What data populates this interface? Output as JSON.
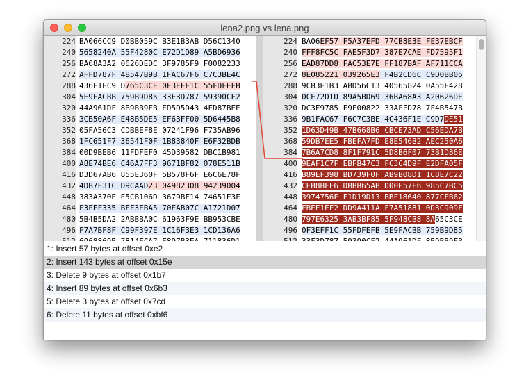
{
  "window": {
    "title": "lena2.png vs lena.png"
  },
  "left_pane": {
    "rows": [
      {
        "num": "224",
        "cells": [
          {
            "t": "BA066CC9 D0BB059C B3E1B3AB D56C1340",
            "c": "none"
          }
        ]
      },
      {
        "num": "240",
        "cells": [
          {
            "t": "5658240A 55F4280C E72D1D89 A5BD6936",
            "c": "blue"
          }
        ]
      },
      {
        "num": "256",
        "cells": [
          {
            "t": "BA68A3A2 0626DEDC 3F9785F9 F0082233",
            "c": "none"
          }
        ]
      },
      {
        "num": "272",
        "cells": [
          {
            "t": "AFFD787F 4B547B9B 1FAC67F6 C7C3BE4C",
            "c": "blue"
          }
        ]
      },
      {
        "num": "288",
        "cells": [
          {
            "t": "436F1EC9 D",
            "c": "none"
          },
          {
            "t": "765C3CE 0F3EFF1C 55FDFEFB",
            "c": "pink"
          }
        ]
      },
      {
        "num": "304",
        "cells": [
          {
            "t": "5E9FACBB 759B9D85 33F3D787 59390CF2",
            "c": "blue"
          }
        ]
      },
      {
        "num": "320",
        "cells": [
          {
            "t": "44A961DF 8B9BB9FB ED5D5D43 4FD87BEE",
            "c": "none"
          }
        ]
      },
      {
        "num": "336",
        "cells": [
          {
            "t": "3CB50A6F E48B5DE5 EF63FF00 5D6445B8",
            "c": "blue"
          }
        ]
      },
      {
        "num": "352",
        "cells": [
          {
            "t": "05FA56C3 CDBBEF8E 07241F96 F735AB96",
            "c": "none"
          }
        ]
      },
      {
        "num": "368",
        "cells": [
          {
            "t": "1FC651F7 36541F0F 1B83840F E6F32BDB",
            "c": "blue"
          }
        ]
      },
      {
        "num": "384",
        "cells": [
          {
            "t": "00D9BEB6 11FDFEF0 45D39582 DBC1B981",
            "c": "none"
          }
        ]
      },
      {
        "num": "400",
        "cells": [
          {
            "t": "A8E74BE6 C46A7FF3 9671BF82 078E511B",
            "c": "blue"
          }
        ]
      },
      {
        "num": "416",
        "cells": [
          {
            "t": "D3D67AB6 855E360F 5B578F6F E6C6E78F",
            "c": "none"
          }
        ]
      },
      {
        "num": "432",
        "cells": [
          {
            "t": "4DB7F31C D9CAAD",
            "c": "blue"
          },
          {
            "t": "23 04982308 94239004",
            "c": "pink"
          }
        ]
      },
      {
        "num": "448",
        "cells": [
          {
            "t": "383A370E E5CB106D 3679BF14 74651E3F",
            "c": "none"
          }
        ]
      },
      {
        "num": "464",
        "cells": [
          {
            "t": "F3FEF335 BFF3EBA5 70EAB07C A1721D07",
            "c": "blue"
          }
        ]
      },
      {
        "num": "480",
        "cells": [
          {
            "t": "5B4B5DA2 2ABBBA0C 61963F9E BB953CBE",
            "c": "none"
          }
        ]
      },
      {
        "num": "496",
        "cells": [
          {
            "t": "F7A7BF8F C99F397E 1C16F3E3 1CD136A6",
            "c": "blue"
          }
        ]
      },
      {
        "num": "512",
        "cells": [
          {
            "t": "6968869B 7814FCA7 E897B3EA 711836D1",
            "c": "none"
          }
        ]
      },
      {
        "num": "528",
        "cells": [
          {
            "t": "1CA7D69D C707F4F2 E70B7AEF D76FC6D0",
            "c": "blue"
          }
        ]
      },
      {
        "num": "544",
        "cells": [
          {
            "t": "21DE5EA7 B811AD7D 0E5F17E7 CFD9EEF5",
            "c": "none"
          }
        ]
      }
    ]
  },
  "right_pane": {
    "rows": [
      {
        "num": "224",
        "cells": [
          {
            "t": "BA06",
            "c": "none"
          },
          {
            "t": "EF57 F5A37EFD 77CB8E3E FE37EBCF",
            "c": "pink"
          }
        ]
      },
      {
        "num": "240",
        "cells": [
          {
            "t": "FFF8FC5C FAE5F3D7 387E7CAE FD7595F1",
            "c": "pink"
          }
        ]
      },
      {
        "num": "256",
        "cells": [
          {
            "t": "EAD87DD8 FAC53E7E FF187BAF AF711CCA",
            "c": "pink"
          }
        ]
      },
      {
        "num": "272",
        "cells": [
          {
            "t": "8E085221 039265E3",
            "c": "pink"
          },
          {
            "t": " F4B2CD6C C9D0BB05",
            "c": "blue"
          }
        ]
      },
      {
        "num": "288",
        "cells": [
          {
            "t": "9CB3E1B3 ABD56C13 40565824 0A55F428",
            "c": "none"
          }
        ]
      },
      {
        "num": "304",
        "cells": [
          {
            "t": "0CE72D1D 89A5BD69 36BA68A3 A20626DE",
            "c": "blue"
          }
        ]
      },
      {
        "num": "320",
        "cells": [
          {
            "t": "DC3F9785 F9F00822 33AFFD78 7F4B547B",
            "c": "none"
          }
        ]
      },
      {
        "num": "336",
        "cells": [
          {
            "t": "9B1FAC67 F6C7C3BE 4C436F1E C9D7",
            "c": "blue"
          },
          {
            "t": "DE51",
            "c": "red"
          }
        ]
      },
      {
        "num": "352",
        "cells": [
          {
            "t": "1D63D49B 47B668B6 CBCE73AD C56EDA7B",
            "c": "red"
          }
        ]
      },
      {
        "num": "368",
        "cells": [
          {
            "t": "59DB7EE5 FBEFA7FD E8E546B2 AEC250A6",
            "c": "red"
          }
        ]
      },
      {
        "num": "384",
        "cells": [
          {
            "t": "7B6A7CD8 8F1F791C 5D8B6F07 73B1D86E",
            "c": "red"
          }
        ]
      },
      {
        "num": "400",
        "cells": [
          {
            "t": "9EAF1C7F EBFB47C3 FC3C4D9F E2DFA05F",
            "c": "red"
          }
        ]
      },
      {
        "num": "416",
        "cells": [
          {
            "t": "B89EF398 BD739F0F AB9B08D1 1C8E7C22",
            "c": "red"
          }
        ]
      },
      {
        "num": "432",
        "cells": [
          {
            "t": "CEB8BFF6 DBBB65AB D00E57F6 985C7BC5",
            "c": "red"
          }
        ]
      },
      {
        "num": "448",
        "cells": [
          {
            "t": "3974756F F1D19D13 BBF18640 877CFB62",
            "c": "red"
          }
        ]
      },
      {
        "num": "464",
        "cells": [
          {
            "t": "FBEE1EF2 DD9A411A F7A51881 0D3C909F",
            "c": "red"
          }
        ]
      },
      {
        "num": "480",
        "cells": [
          {
            "t": "797E6325 3AB3BF85 5F948CB8 8A",
            "c": "red"
          },
          {
            "t": "65C3CE",
            "c": "none"
          }
        ]
      },
      {
        "num": "496",
        "cells": [
          {
            "t": "0F3EFF1C 55FDFEFB 5E9FACBB 759B9D85",
            "c": "blue"
          }
        ]
      },
      {
        "num": "512",
        "cells": [
          {
            "t": "33F3D787 59390CF2 44A961DF 8B9BB9FB",
            "c": "none"
          }
        ]
      },
      {
        "num": "528",
        "cells": [
          {
            "t": "ED5D5D43 4FD87BEE 3CB50A6F E48B5DE5",
            "c": "blue"
          }
        ]
      },
      {
        "num": "544",
        "cells": [
          {
            "t": "EF63FF00 5D6445B8 05FA56C3 CDBBEF8E",
            "c": "none"
          }
        ]
      }
    ]
  },
  "changes": [
    {
      "label": "1: Insert 57 bytes at offset 0xe2"
    },
    {
      "label": "2: Insert 143 bytes at offset 0x15e"
    },
    {
      "label": "3: Delete 9 bytes at offset 0x1b7"
    },
    {
      "label": "4: Insert 89 bytes at offset 0x6b3"
    },
    {
      "label": "5: Delete 3 bytes at offset 0x7cd"
    },
    {
      "label": "6: Delete 11 bytes at offset 0xbf6"
    }
  ],
  "selected_change_index": 1,
  "colors": {
    "inserted": "#9e2a1e",
    "modified": "#fad9d6",
    "alternate_row": "#e2ebf9",
    "connector": "#e04a3a"
  }
}
